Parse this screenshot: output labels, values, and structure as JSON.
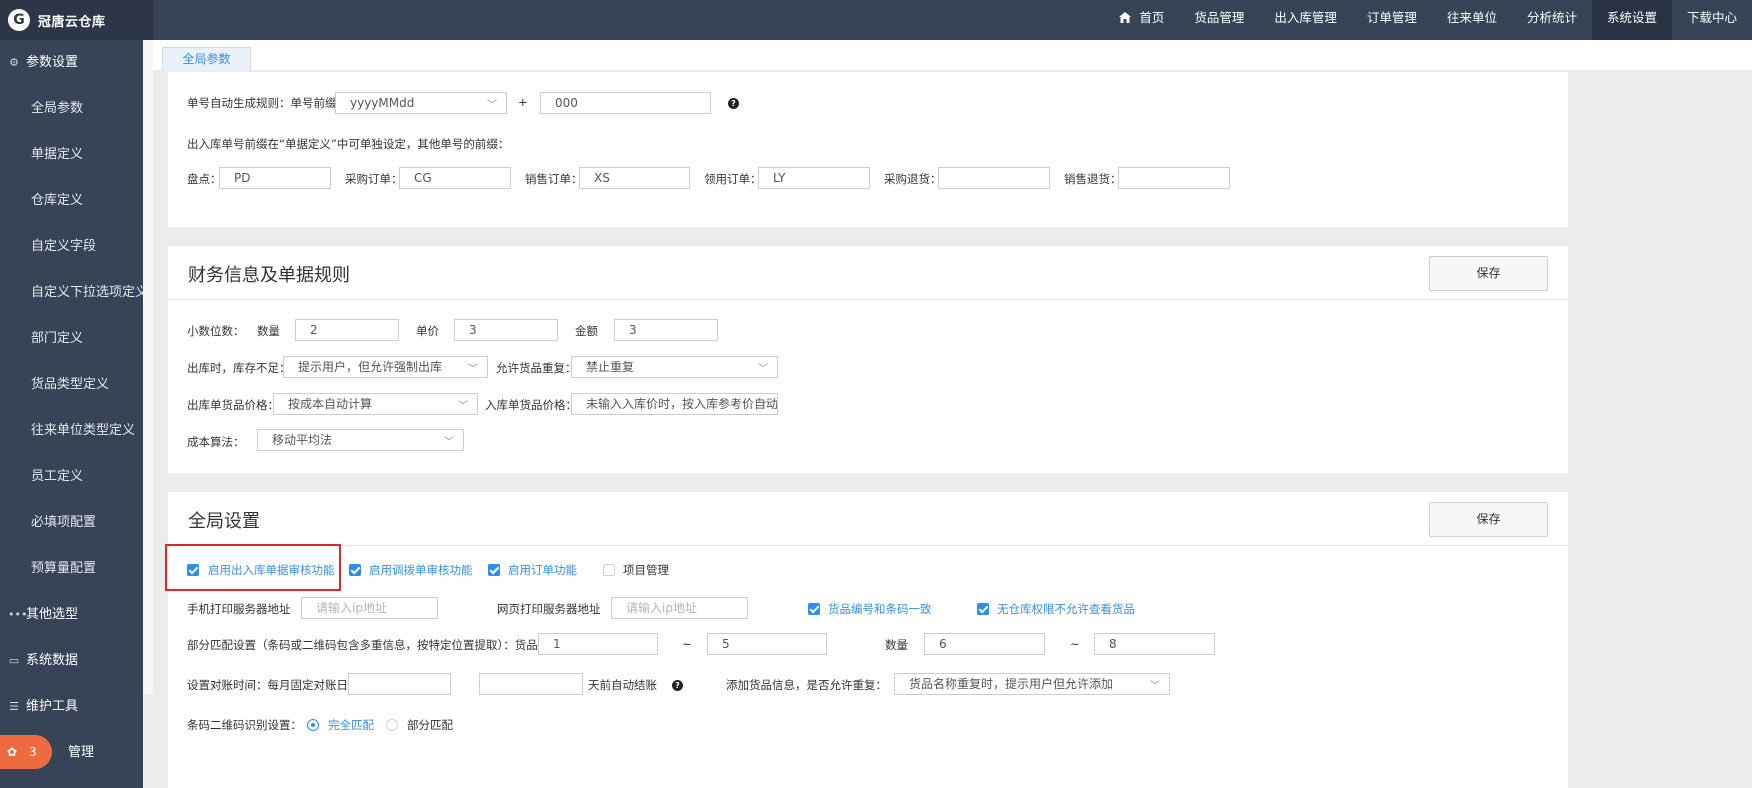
{
  "app": {
    "name": "冠唐云仓库"
  },
  "nav": [
    "首页",
    "货品管理",
    "出入库管理",
    "订单管理",
    "往来单位",
    "分析统计",
    "系统设置",
    "下载中心"
  ],
  "sidebar": {
    "group1": "参数设置",
    "subs": [
      "全局参数",
      "单据定义",
      "仓库定义",
      "自定义字段",
      "自定义下拉选项定义",
      "部门定义",
      "货品类型定义",
      "往来单位类型定义",
      "员工定义",
      "必填项配置",
      "预算量配置"
    ],
    "group2": "其他选型",
    "group3": "系统数据",
    "group4": "维护工具",
    "group5": "管理",
    "badge": "3"
  },
  "tabs": [
    "全局参数"
  ],
  "numbering": {
    "rule_label": "单号自动生成规则：单号前缀+",
    "date_format": "yyyyMMdd",
    "plus": "+",
    "suffix": "000",
    "note": "出入库单号前缀在“单据定义”中可单独设定，其他单号的前缀：",
    "fields": [
      {
        "label": "盘点：",
        "value": "PD"
      },
      {
        "label": "采购订单：",
        "value": "CG"
      },
      {
        "label": "销售订单：",
        "value": "XS"
      },
      {
        "label": "领用订单：",
        "value": "LY"
      },
      {
        "label": "采购退货：",
        "value": ""
      },
      {
        "label": "销售退货：",
        "value": ""
      }
    ]
  },
  "finance": {
    "title": "财务信息及单据规则",
    "save": "保存",
    "decimals_label": "小数位数：",
    "qty_label": "数量",
    "qty": "2",
    "price_label": "单价",
    "price": "3",
    "amount_label": "金额",
    "amount": "3",
    "stock_short_label": "出库时，库存不足：",
    "stock_short": "提示用户，但允许强制出库",
    "dup_label": "允许货品重复：",
    "dup": "禁止重复",
    "out_price_label": "出库单货品价格：",
    "out_price": "按成本自动计算",
    "in_price_label": "入库单货品价格：",
    "in_price": "未输入入库价时，按入库参考价自动",
    "cost_label": "成本算法：",
    "cost": "移动平均法"
  },
  "global": {
    "title": "全局设置",
    "save": "保存",
    "cb1": "启用出入库单据审核功能",
    "cb2": "启用调拨单审核功能",
    "cb3": "启用订单功能",
    "cb4": "项目管理",
    "mobile_print_label": "手机打印服务器地址",
    "mobile_print_ph": "请输入ip地址",
    "web_print_label": "网页打印服务器地址",
    "web_print_ph": "请输入ip地址",
    "cb5": "货品编号和条码一致",
    "cb6": "无仓库权限不允许查看货品",
    "partial_label": "部分匹配设置（条码或二维码包含多重信息，按特定位置提取）：货品",
    "g_from": "1",
    "tilde1": "~",
    "g_to": "5",
    "qty_label": "数量",
    "q_from": "6",
    "tilde2": "~",
    "q_to": "8",
    "recon_label": "设置对账时间：每月固定对账日：",
    "recon_day": "",
    "auto_days": "",
    "auto_label": "天前自动结账",
    "add_goods_label": "添加货品信息，是否允许重复：",
    "add_goods": "货品名称重复时，提示用户但允许添加",
    "barcode_label": "条码二维码识别设置：",
    "radio1": "完全匹配",
    "radio2": "部分匹配"
  }
}
